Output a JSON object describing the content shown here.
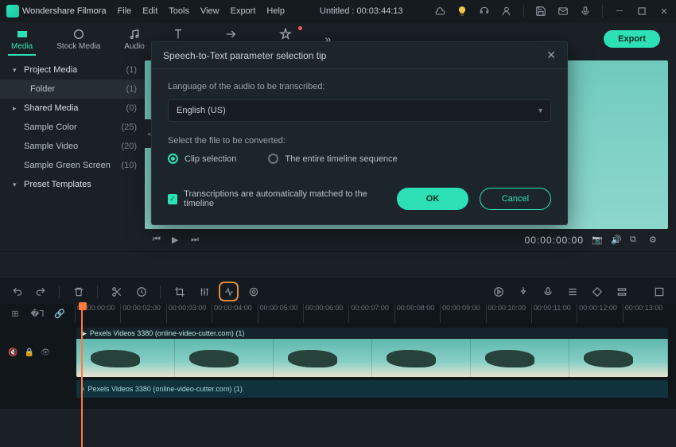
{
  "titlebar": {
    "app": "Wondershare Filmora",
    "menu": [
      "File",
      "Edit",
      "Tools",
      "View",
      "Export",
      "Help"
    ],
    "doc": "Untitled : 00:03:44:13"
  },
  "tabs": {
    "items": [
      "Media",
      "Stock Media",
      "Audio",
      "Titles",
      "Transitions",
      "Effects"
    ],
    "more": "»",
    "export": "Export"
  },
  "sidebar": {
    "rows": [
      {
        "label": "Project Media",
        "count": "(1)",
        "chev": "▾",
        "bold": true
      },
      {
        "label": "Folder",
        "count": "(1)",
        "child": true
      },
      {
        "label": "Shared Media",
        "count": "(0)",
        "chev": "▸",
        "bold": true
      },
      {
        "label": "Sample Color",
        "count": "(25)"
      },
      {
        "label": "Sample Video",
        "count": "(20)"
      },
      {
        "label": "Sample Green Screen",
        "count": "(10)"
      },
      {
        "label": "Preset Templates",
        "chev": "▾",
        "bold": true
      }
    ]
  },
  "preview": {
    "time": "00:00:00:00"
  },
  "ruler": {
    "ticks": [
      "00:00:00:00",
      "00:00:02:00",
      "00:00:03:00",
      "00:00:04:00",
      "00:00:05:00",
      "00:00:06:00",
      "00:00:07:00",
      "00:00:08:00",
      "00:00:09:00",
      "00:00:10:00",
      "00:00:11:00",
      "00:00:12:00",
      "00:00:13:00"
    ]
  },
  "clip": {
    "video": "Pexels Videos 3380 (online-video-cutter.com) (1)",
    "audio": "Pexels Videos 3380 (online-video-cutter.com) (1)"
  },
  "dialog": {
    "title": "Speech-to-Text parameter selection tip",
    "lang_label": "Language of the audio to be transcribed:",
    "lang_value": "English (US)",
    "file_label": "Select the file to be converted:",
    "opt_clip": "Clip selection",
    "opt_timeline": "The entire timeline sequence",
    "auto_match": "Transcriptions are automatically matched to the timeline",
    "ok": "OK",
    "cancel": "Cancel"
  }
}
